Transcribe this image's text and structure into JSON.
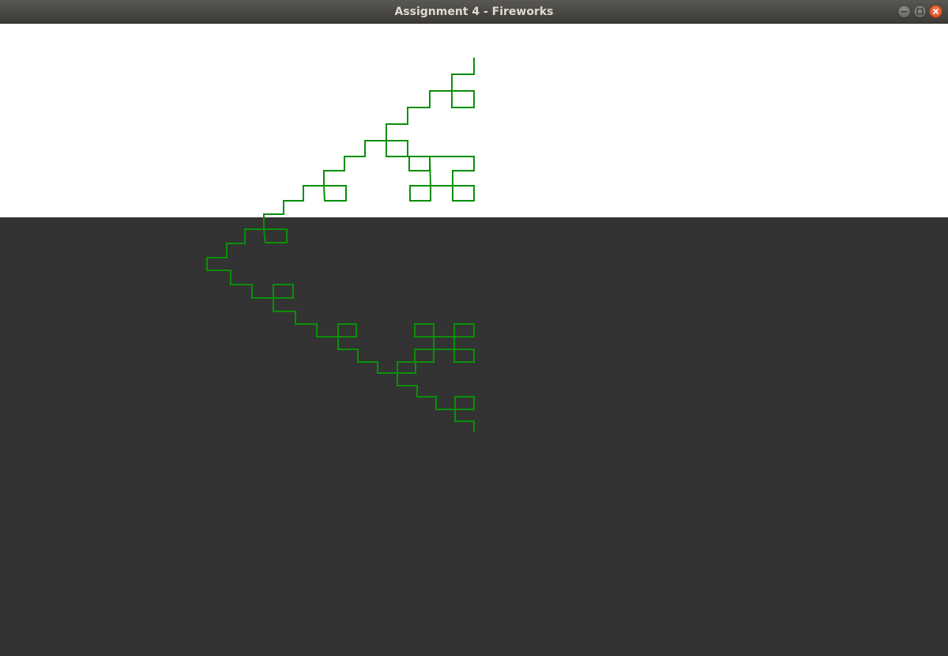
{
  "window": {
    "title": "Assignment 4 - Fireworks"
  },
  "controls": {
    "minimize_icon": "minimize-icon",
    "maximize_icon": "maximize-icon",
    "close_icon": "close-icon"
  },
  "colors": {
    "sky": "#ffffff",
    "ground": "#333333",
    "stroke": "#0a8f0a",
    "titlebar": "#3c3b37",
    "close": "#e95420"
  }
}
